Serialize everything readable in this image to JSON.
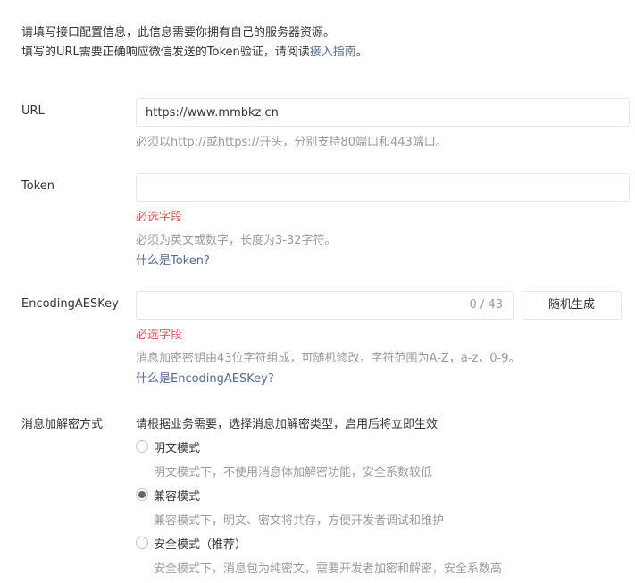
{
  "intro": {
    "line1": "请填写接口配置信息，此信息需要你拥有自己的服务器资源。",
    "line2_prefix": "填写的URL需要正确响应微信发送的Token验证，请阅读",
    "line2_link": "接入指南",
    "line2_suffix": "。"
  },
  "url": {
    "label": "URL",
    "value": "https://www.mmbkz.cn",
    "tip": "必须以http://或https://开头，分别支持80端口和443端口。"
  },
  "token": {
    "label": "Token",
    "value": "",
    "error": "必选字段",
    "tip": "必须为英文或数字，长度为3-32字符。",
    "help_link": "什么是Token?"
  },
  "aeskey": {
    "label": "EncodingAESKey",
    "value": "",
    "counter": "0 / 43",
    "button": "随机生成",
    "error": "必选字段",
    "tip": "消息加密密钥由43位字符组成，可随机修改，字符范围为A-Z，a-z，0-9。",
    "help_link": "什么是EncodingAESKey?"
  },
  "encryption": {
    "label": "消息加解密方式",
    "description": "请根据业务需要，选择消息加解密类型，启用后将立即生效",
    "options": [
      {
        "label": "明文模式",
        "sub": "明文模式下，不使用消息体加解密功能，安全系数较低",
        "checked": false
      },
      {
        "label": "兼容模式",
        "sub": "兼容模式下，明文、密文将共存，方便开发者调试和维护",
        "checked": true
      },
      {
        "label": "安全模式（推荐）",
        "sub": "安全模式下，消息包为纯密文，需要开发者加密和解密，安全系数高",
        "checked": false
      }
    ]
  },
  "colors": {
    "error": "#fa5151",
    "link": "#576b95",
    "hint": "#9a9a9a",
    "text": "#353535"
  }
}
